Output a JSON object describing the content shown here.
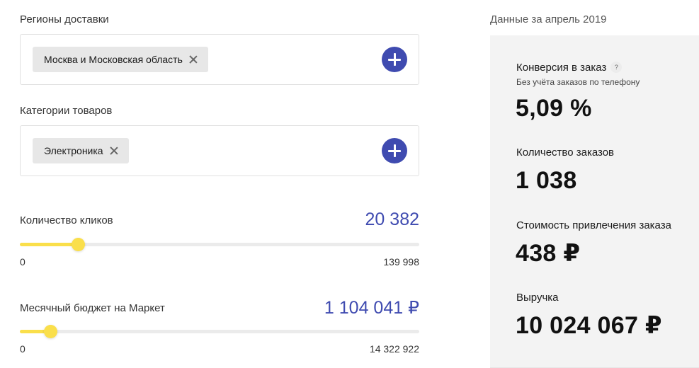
{
  "regions": {
    "label": "Регионы доставки",
    "tag": "Москва и Московская область"
  },
  "categories": {
    "label": "Категории товаров",
    "tag": "Электроника"
  },
  "clicks": {
    "label": "Количество кликов",
    "value": "20 382",
    "min": "0",
    "max": "139 998",
    "level_fraction": 0.145
  },
  "budget": {
    "label": "Месячный бюджет на Маркет",
    "value": "1 104 041 ₽",
    "min": "0",
    "max": "14 322 922",
    "level_fraction": 0.077
  },
  "stats": {
    "header": "Данные за апрель 2019",
    "conversion": {
      "label": "Конверсия в заказ",
      "help": "?",
      "sub": "Без учёта заказов по телефону",
      "value": "5,09 %"
    },
    "orders": {
      "label": "Количество заказов",
      "value": "1 038"
    },
    "cost": {
      "label": "Стоимость привлечения заказа",
      "value": "438 ₽"
    },
    "revenue": {
      "label": "Выручка",
      "value": "10 024 067 ₽"
    }
  },
  "colors": {
    "accent": "#3f4bb0",
    "slider": "#fadf4b",
    "panel": "#f3f3f3"
  }
}
